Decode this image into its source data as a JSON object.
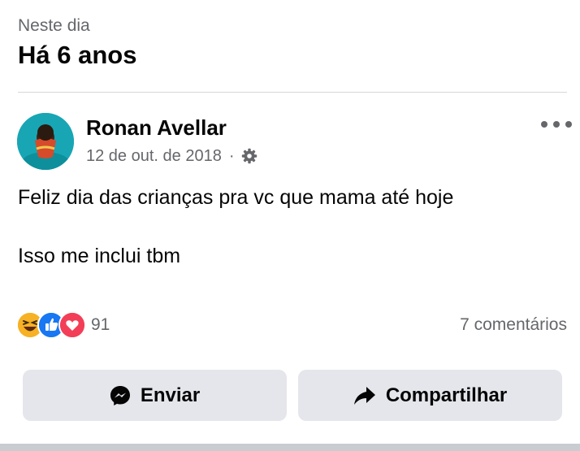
{
  "memory": {
    "kicker": "Neste dia",
    "title": "Há 6 anos"
  },
  "post": {
    "author": "Ronan Avellar",
    "date": "12 de out. de 2018",
    "separator": "·",
    "audience_icon": "gear-icon",
    "lines": [
      "Feliz dia das crianças pra vc que mama até hoje",
      "Isso me inclui tbm"
    ]
  },
  "reactions": {
    "icons": [
      "haha-emoji-icon",
      "like-icon",
      "love-icon"
    ],
    "count": "91",
    "comments": "7 comentários"
  },
  "actions": {
    "send_label": "Enviar",
    "share_label": "Compartilhar"
  },
  "colors": {
    "button_bg": "#e4e6eb",
    "secondary_text": "#65676b",
    "like_blue": "#1877f2",
    "love_red": "#f33e58",
    "haha_yellow": "#f7b125"
  }
}
